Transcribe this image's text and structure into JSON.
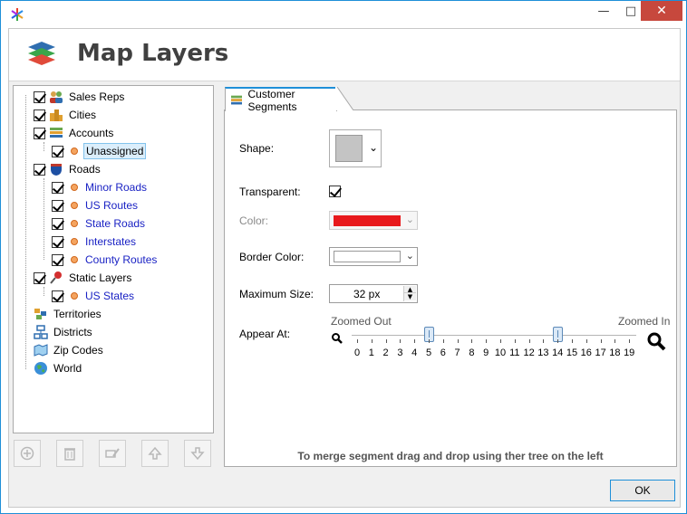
{
  "window": {
    "title_controls": {
      "minimize": "—",
      "maximize": "□",
      "close": "✕"
    }
  },
  "header": {
    "title": "Map Layers",
    "logo_icon": "layers-stack-icon"
  },
  "tree": {
    "items": [
      {
        "label": "Sales Reps",
        "checked": true,
        "icon": "people-icon"
      },
      {
        "label": "Cities",
        "checked": true,
        "icon": "city-buildings-icon"
      },
      {
        "label": "Accounts",
        "checked": true,
        "icon": "table-stack-icon"
      },
      {
        "label": "Unassigned",
        "checked": true,
        "icon": "orange-dot-icon",
        "selected": true
      },
      {
        "label": "Roads",
        "checked": true,
        "icon": "interstate-shield-icon"
      },
      {
        "label": "Minor Roads",
        "checked": true,
        "icon": "orange-dot-icon"
      },
      {
        "label": "US Routes",
        "checked": true,
        "icon": "orange-dot-icon"
      },
      {
        "label": "State Roads",
        "checked": true,
        "icon": "orange-dot-icon"
      },
      {
        "label": "Interstates",
        "checked": true,
        "icon": "orange-dot-icon"
      },
      {
        "label": "County Routes",
        "checked": true,
        "icon": "orange-dot-icon"
      },
      {
        "label": "Static Layers",
        "checked": true,
        "icon": "pushpin-icon"
      },
      {
        "label": "US States",
        "checked": true,
        "icon": "orange-dot-icon"
      },
      {
        "label": "Territories",
        "icon": "territories-icon"
      },
      {
        "label": "Districts",
        "icon": "districts-icon"
      },
      {
        "label": "Zip Codes",
        "icon": "zip-map-icon"
      },
      {
        "label": "World",
        "icon": "globe-icon"
      }
    ]
  },
  "toolbar": {
    "buttons": [
      "add-icon",
      "trash-icon",
      "edit-icon",
      "arrow-up-icon",
      "arrow-down-icon"
    ]
  },
  "tab": {
    "label": "Customer Segments"
  },
  "form": {
    "shape_label": "Shape:",
    "transparent_label": "Transparent:",
    "transparent_checked": true,
    "color_label": "Color:",
    "color_value": "#e8191c",
    "border_color_label": "Border Color:",
    "border_color_value": "#ffffff",
    "max_size_label": "Maximum Size:",
    "max_size_value": "32 px",
    "appear_at_label": "Appear At:",
    "zoomed_out_label": "Zoomed Out",
    "zoomed_in_label": "Zoomed In",
    "slider_range": [
      0,
      19
    ],
    "slider_low": 5,
    "slider_high": 14,
    "tick_labels": [
      "0",
      "1",
      "2",
      "3",
      "4",
      "5",
      "6",
      "7",
      "8",
      "9",
      "10",
      "11",
      "12",
      "13",
      "14",
      "15",
      "16",
      "17",
      "18",
      "19"
    ]
  },
  "hint": "To merge segment drag and drop using ther tree on the left",
  "footer": {
    "ok_label": "OK"
  }
}
